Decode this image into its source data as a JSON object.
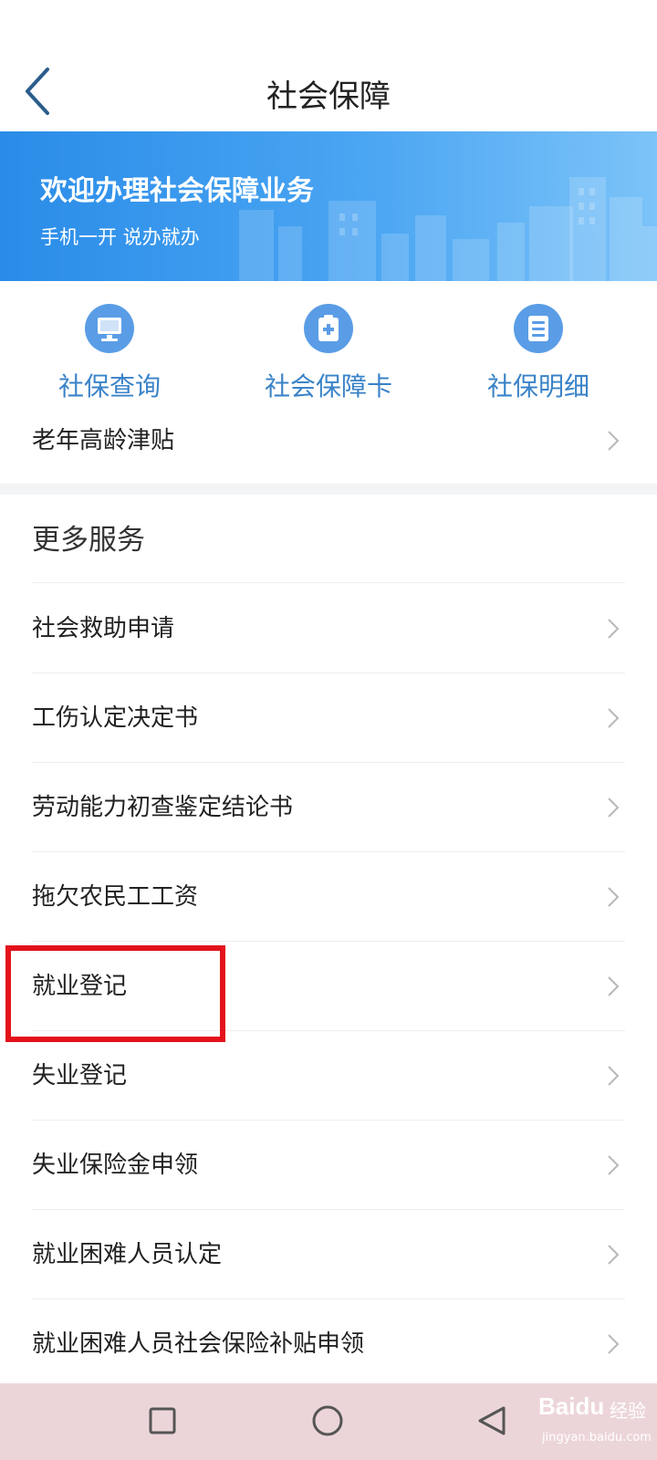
{
  "header": {
    "title": "社会保障"
  },
  "banner": {
    "title": "欢迎办理社会保障业务",
    "subtitle": "手机一开 说办就办"
  },
  "quick_actions": [
    {
      "label": "社保查询",
      "icon": "monitor-icon"
    },
    {
      "label": "社会保障卡",
      "icon": "medical-card-icon"
    },
    {
      "label": "社保明细",
      "icon": "document-list-icon"
    }
  ],
  "top_list": [
    {
      "label": "老年高龄津贴"
    }
  ],
  "more_services": {
    "title": "更多服务",
    "items": [
      {
        "label": "社会救助申请"
      },
      {
        "label": "工伤认定决定书"
      },
      {
        "label": "劳动能力初查鉴定结论书"
      },
      {
        "label": "拖欠农民工工资"
      },
      {
        "label": "就业登记"
      },
      {
        "label": "失业登记"
      },
      {
        "label": "失业保险金申领"
      },
      {
        "label": "就业困难人员认定"
      },
      {
        "label": "就业困难人员社会保险补贴申领"
      }
    ]
  },
  "navbar": {
    "buttons": [
      "recents-square",
      "home-circle",
      "back-triangle"
    ]
  },
  "watermark": {
    "logo": "Baidu",
    "name": "经验",
    "url": "jingyan.baidu.com"
  },
  "colors": {
    "accent": "#3a83c8",
    "banner_start": "#2a8ce8",
    "highlight": "#e3121c",
    "navbar": "#ecd5d8"
  }
}
